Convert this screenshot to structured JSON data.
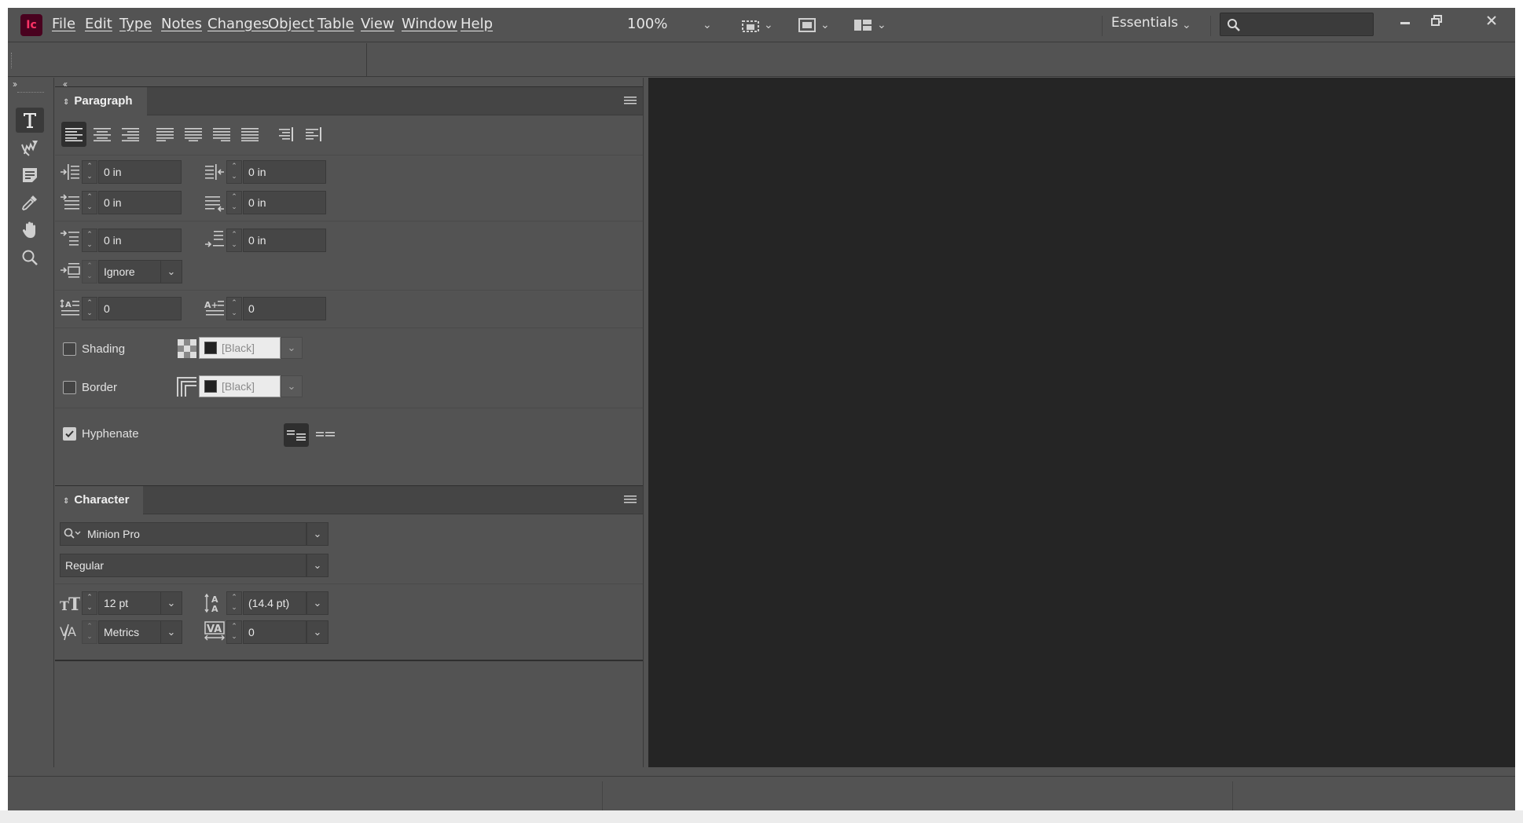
{
  "app": {
    "logo": "Ic"
  },
  "menu": {
    "items": [
      "File",
      "Edit",
      "Type",
      "Notes",
      "Changes",
      "Object",
      "Table",
      "View",
      "Window",
      "Help"
    ],
    "zoom": "100%",
    "workspace": "Essentials"
  },
  "icons": {
    "logo": "incopy-logo",
    "search": "search-icon",
    "minimize": "minimize-icon",
    "restore": "restore-icon",
    "close": "close-icon",
    "tools": [
      "type-tool-icon",
      "position-tool-icon",
      "note-tool-icon",
      "eyedropper-tool-icon",
      "hand-tool-icon",
      "zoom-tool-icon"
    ]
  },
  "paragraph": {
    "title": "Paragraph",
    "left_indent": "0 in",
    "right_indent": "0 in",
    "first_line_indent": "0 in",
    "last_line_indent": "0 in",
    "space_before": "0 in",
    "space_after": "0 in",
    "align_to_grid": "Ignore",
    "drop_cap_lines": "0",
    "drop_cap_chars": "0",
    "shading_label": "Shading",
    "shading_swatch": "[Black]",
    "shading_checked": false,
    "border_label": "Border",
    "border_swatch": "[Black]",
    "border_checked": false,
    "hyphenate_label": "Hyphenate",
    "hyphenate_checked": true
  },
  "character": {
    "title": "Character",
    "font_family": "Minion Pro",
    "font_style": "Regular",
    "font_size": "12 pt",
    "leading": "(14.4 pt)",
    "kerning": "Metrics",
    "tracking": "0"
  },
  "colors": {
    "ui_bg": "#535353",
    "doc_bg": "#252525",
    "logo_bg": "#49021f",
    "logo_fg": "#ff3366"
  }
}
